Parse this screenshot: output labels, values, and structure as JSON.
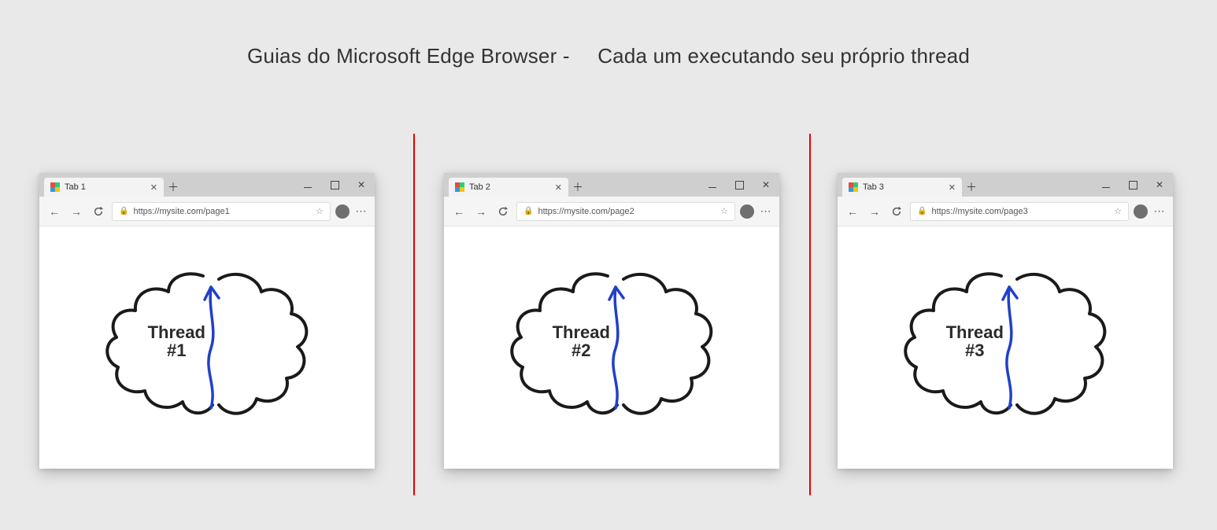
{
  "heading": {
    "part_a": "Guias do Microsoft Edge Browser -",
    "part_b": "Cada um executando seu próprio thread"
  },
  "dividers": {
    "color": "#e60000"
  },
  "windows": [
    {
      "tab_title": "Tab 1",
      "url": "https://mysite.com/page1",
      "thread_line1": "Thread",
      "thread_line2": "#1"
    },
    {
      "tab_title": "Tab 2",
      "url": "https://mysite.com/page2",
      "thread_line1": "Thread",
      "thread_line2": "#2"
    },
    {
      "tab_title": "Tab 3",
      "url": "https://mysite.com/page3",
      "thread_line1": "Thread",
      "thread_line2": "#3"
    }
  ]
}
